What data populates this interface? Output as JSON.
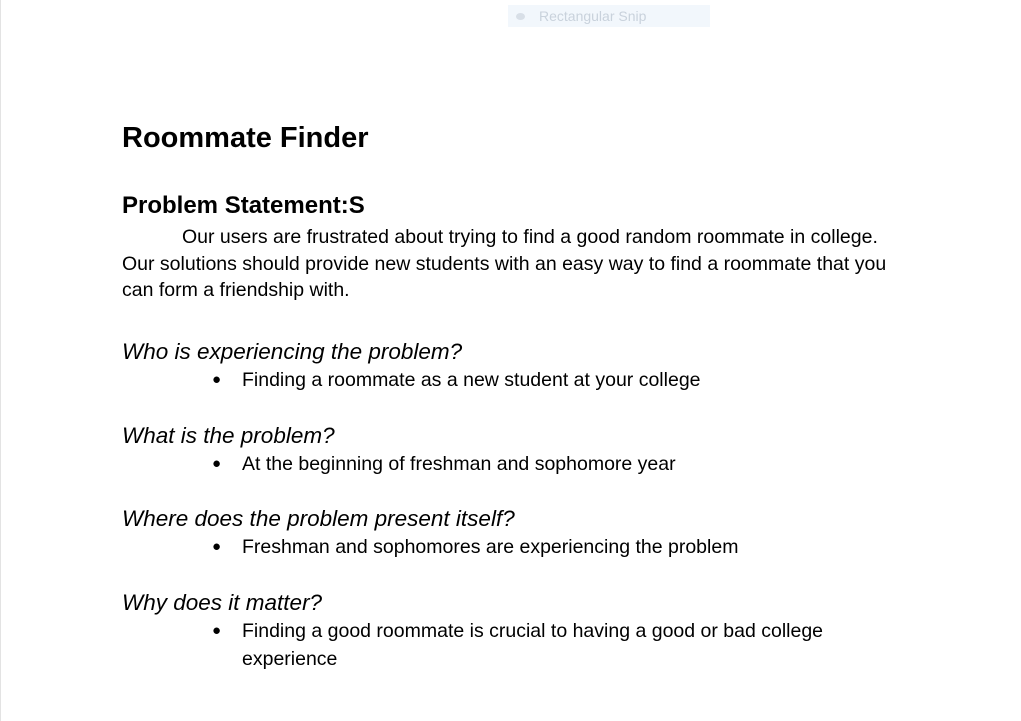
{
  "overlay": {
    "label": "Rectangular Snip",
    "icon": "snip-record-icon"
  },
  "document": {
    "title": "Roommate Finder",
    "subtitle": "Problem Statement:S",
    "paragraph": "Our users are frustrated about trying to find a good random roommate in college. Our solutions should provide new students with an easy way to find a roommate that you can form a friendship with.",
    "sections": [
      {
        "question": "Who is experiencing the problem?",
        "bullet": "Finding a roommate as a new student at your college"
      },
      {
        "question": "What is the problem?",
        "bullet": "At the beginning of freshman and sophomore year"
      },
      {
        "question": "Where does the problem present itself?",
        "bullet": "Freshman and sophomores are experiencing the problem"
      },
      {
        "question": "Why does it matter?",
        "bullet": "Finding a good roommate is crucial to having a good or bad college experience"
      }
    ]
  }
}
